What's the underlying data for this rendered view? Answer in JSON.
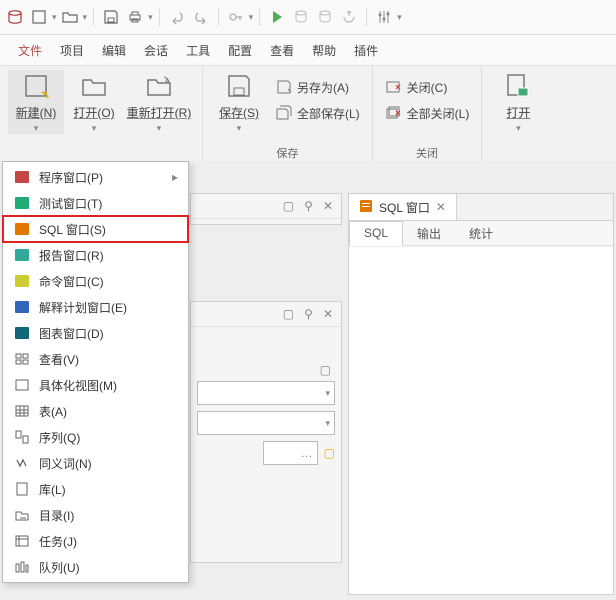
{
  "menubar": {
    "file": "文件",
    "project": "项目",
    "edit": "编辑",
    "session": "会话",
    "tools": "工具",
    "config": "配置",
    "view": "查看",
    "help": "帮助",
    "plugin": "插件"
  },
  "ribbon": {
    "new": "新建(N)",
    "open": "打开(O)",
    "reopen": "重新打开(R)",
    "save": "保存(S)",
    "saveAs": "另存为(A)",
    "saveAll": "全部保存(L)",
    "close": "关闭(C)",
    "closeAll": "全部关闭(L)",
    "open2": "打开",
    "groupSave": "保存",
    "groupClose": "关闭"
  },
  "ctx": {
    "programWin": "程序窗口(P)",
    "testWin": "测试窗口(T)",
    "sqlWin": "SQL 窗口(S)",
    "reportWin": "报告窗口(R)",
    "cmdWin": "命令窗口(C)",
    "explainWin": "解释计划窗口(E)",
    "chartWin": "图表窗口(D)",
    "view": "查看(V)",
    "matView": "具体化视图(M)",
    "table": "表(A)",
    "sequence": "序列(Q)",
    "synonym": "同义词(N)",
    "library": "库(L)",
    "directory": "目录(I)",
    "jobs": "任务(J)",
    "queue": "队列(U)"
  },
  "doc": {
    "title": "SQL 窗口",
    "tabSql": "SQL",
    "tabOutput": "输出",
    "tabStats": "统计"
  },
  "colors": {
    "accent": "#b94a4a",
    "highlight": "#d22",
    "sqlIcon": "#e07800"
  }
}
